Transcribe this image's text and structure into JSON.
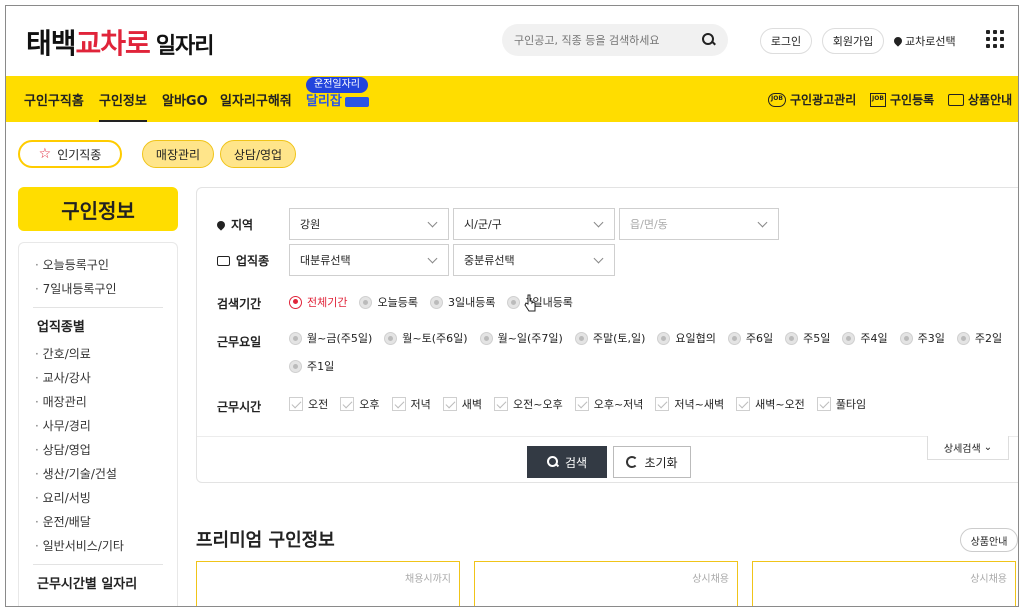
{
  "header": {
    "logo": {
      "part1": "태백",
      "part2": "교차로",
      "part3": "일자리"
    },
    "search_placeholder": "구인공고, 직종 등을 검색하세요",
    "login": "로그인",
    "signup": "회원가입",
    "region": "교차로선택"
  },
  "nav": {
    "items": [
      "구인구직홈",
      "구인정보",
      "알바GO",
      "일자리구해줘",
      "달리잡"
    ],
    "badge": "운전일자리",
    "right": [
      "구인광고관리",
      "구인등록",
      "상품안내"
    ],
    "icon_text": "JOB"
  },
  "chips": {
    "popular": "인기직종",
    "tags": [
      "매장관리",
      "상담/영업"
    ]
  },
  "sidebar": {
    "title": "구인정보",
    "group1": [
      "오늘등록구인",
      "7일내등록구인"
    ],
    "heading2": "업직종별",
    "group2": [
      "간호/의료",
      "교사/강사",
      "매장관리",
      "사무/경리",
      "상담/영업",
      "생산/기술/건설",
      "요리/서빙",
      "운전/배달",
      "일반서비스/기타"
    ],
    "heading3": "근무시간별 일자리"
  },
  "filter": {
    "region_label": "지역",
    "region_values": [
      "강원",
      "시/군/구",
      "읍/면/동"
    ],
    "job_label": "업직종",
    "job_values": [
      "대분류선택",
      "중분류선택"
    ],
    "period_label": "검색기간",
    "period_options": [
      "전체기간",
      "오늘등록",
      "3일내등록",
      "7일내등록"
    ],
    "days_label": "근무요일",
    "days_options": [
      "월~금(주5일)",
      "월~토(주6일)",
      "월~일(주7일)",
      "주말(토,일)",
      "요일협의",
      "주6일",
      "주5일",
      "주4일",
      "주3일",
      "주2일",
      "주1일"
    ],
    "time_label": "근무시간",
    "time_options": [
      "오전",
      "오후",
      "저녁",
      "새벽",
      "오전~오후",
      "오후~저녁",
      "저녁~새벽",
      "새벽~오전",
      "풀타임"
    ],
    "search_btn": "검색",
    "reset_btn": "초기화",
    "detail_btn": "상세검색"
  },
  "premium": {
    "title": "프리미엄 구인정보",
    "info_btn": "상품안내",
    "cards": [
      "채용시까지",
      "상시채용",
      "상시채용"
    ]
  },
  "colors": {
    "yellow": "#ffdd00",
    "red": "#e0243a",
    "blue": "#2244dd",
    "dark_btn": "#333a44"
  }
}
